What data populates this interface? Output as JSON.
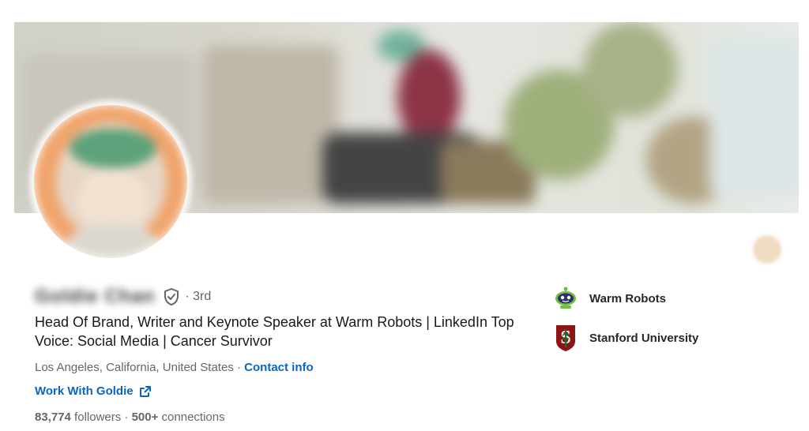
{
  "profile": {
    "name": "Goldie Chan",
    "degree": "· 3rd",
    "headline": "Head Of Brand, Writer and Keynote Speaker at Warm Robots | LinkedIn Top Voice: Social Media | Cancer Survivor",
    "location": "Los Angeles, California, United States",
    "location_separator": " · ",
    "contact_label": "Contact info",
    "website_label": "Work With Goldie",
    "followers_count": "83,774",
    "followers_label": " followers",
    "stats_separator": "  · ",
    "connections_count": "500+",
    "connections_label": " connections"
  },
  "orgs": [
    {
      "label": "Warm Robots",
      "icon": "warm-robots-logo-icon"
    },
    {
      "label": "Stanford University",
      "icon": "stanford-logo-icon"
    }
  ],
  "colors": {
    "link": "#0a66c2",
    "secondary_text": "#666666",
    "avatar_ring": "#f0a46c",
    "stanford_red": "#8c1515"
  }
}
